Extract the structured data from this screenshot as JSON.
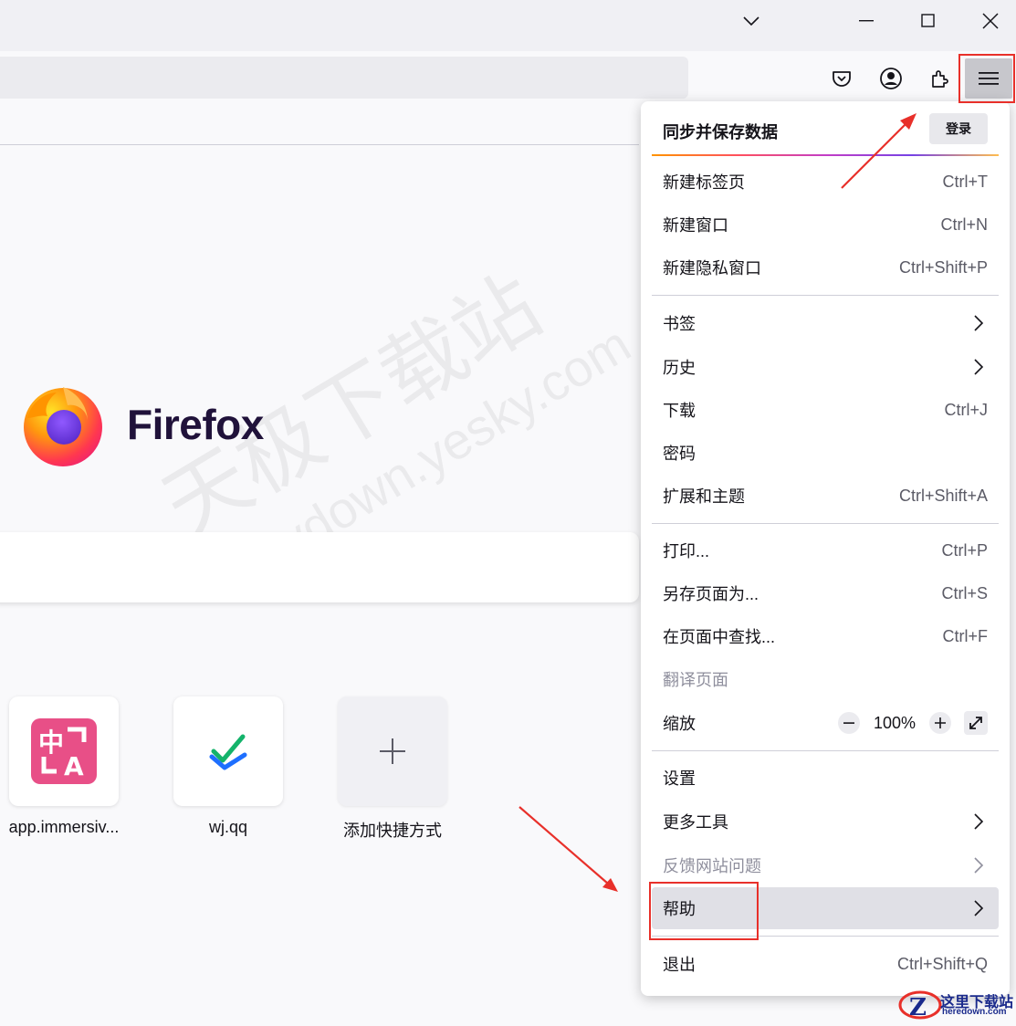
{
  "window": {
    "controls": [
      "list-all-tabs",
      "minimize",
      "maximize",
      "close"
    ]
  },
  "brand": {
    "name": "Firefox"
  },
  "watermark": {
    "line1": "天极下载站",
    "line2": "mydown.yesky.com"
  },
  "shortcuts": [
    {
      "label": "app.immersiv...",
      "icon": "translate-icon",
      "color": "#e84f87"
    },
    {
      "label": "wj.qq",
      "icon": "checkmark-icon"
    },
    {
      "label": "添加快捷方式",
      "icon": "plus-icon"
    }
  ],
  "menu": {
    "sync_title": "同步并保存数据",
    "login_label": "登录",
    "items": {
      "new_tab": {
        "label": "新建标签页",
        "shortcut": "Ctrl+T"
      },
      "new_window": {
        "label": "新建窗口",
        "shortcut": "Ctrl+N"
      },
      "new_private": {
        "label": "新建隐私窗口",
        "shortcut": "Ctrl+Shift+P"
      },
      "bookmarks": {
        "label": "书签"
      },
      "history": {
        "label": "历史"
      },
      "downloads": {
        "label": "下载",
        "shortcut": "Ctrl+J"
      },
      "passwords": {
        "label": "密码"
      },
      "addons": {
        "label": "扩展和主题",
        "shortcut": "Ctrl+Shift+A"
      },
      "print": {
        "label": "打印...",
        "shortcut": "Ctrl+P"
      },
      "save_as": {
        "label": "另存页面为...",
        "shortcut": "Ctrl+S"
      },
      "find": {
        "label": "在页面中查找...",
        "shortcut": "Ctrl+F"
      },
      "translate": {
        "label": "翻译页面"
      },
      "zoom": {
        "label": "缩放",
        "value": "100%",
        "minus": "−",
        "plus": "+"
      },
      "settings": {
        "label": "设置"
      },
      "more_tools": {
        "label": "更多工具"
      },
      "report_site": {
        "label": "反馈网站问题"
      },
      "help": {
        "label": "帮助"
      },
      "quit": {
        "label": "退出",
        "shortcut": "Ctrl+Shift+Q"
      }
    }
  },
  "corner_logo": {
    "title": "这里下载站",
    "site": "heredown.com"
  },
  "colors": {
    "accent_red": "#e8302a",
    "menu_hover": "#e0e0e6"
  }
}
